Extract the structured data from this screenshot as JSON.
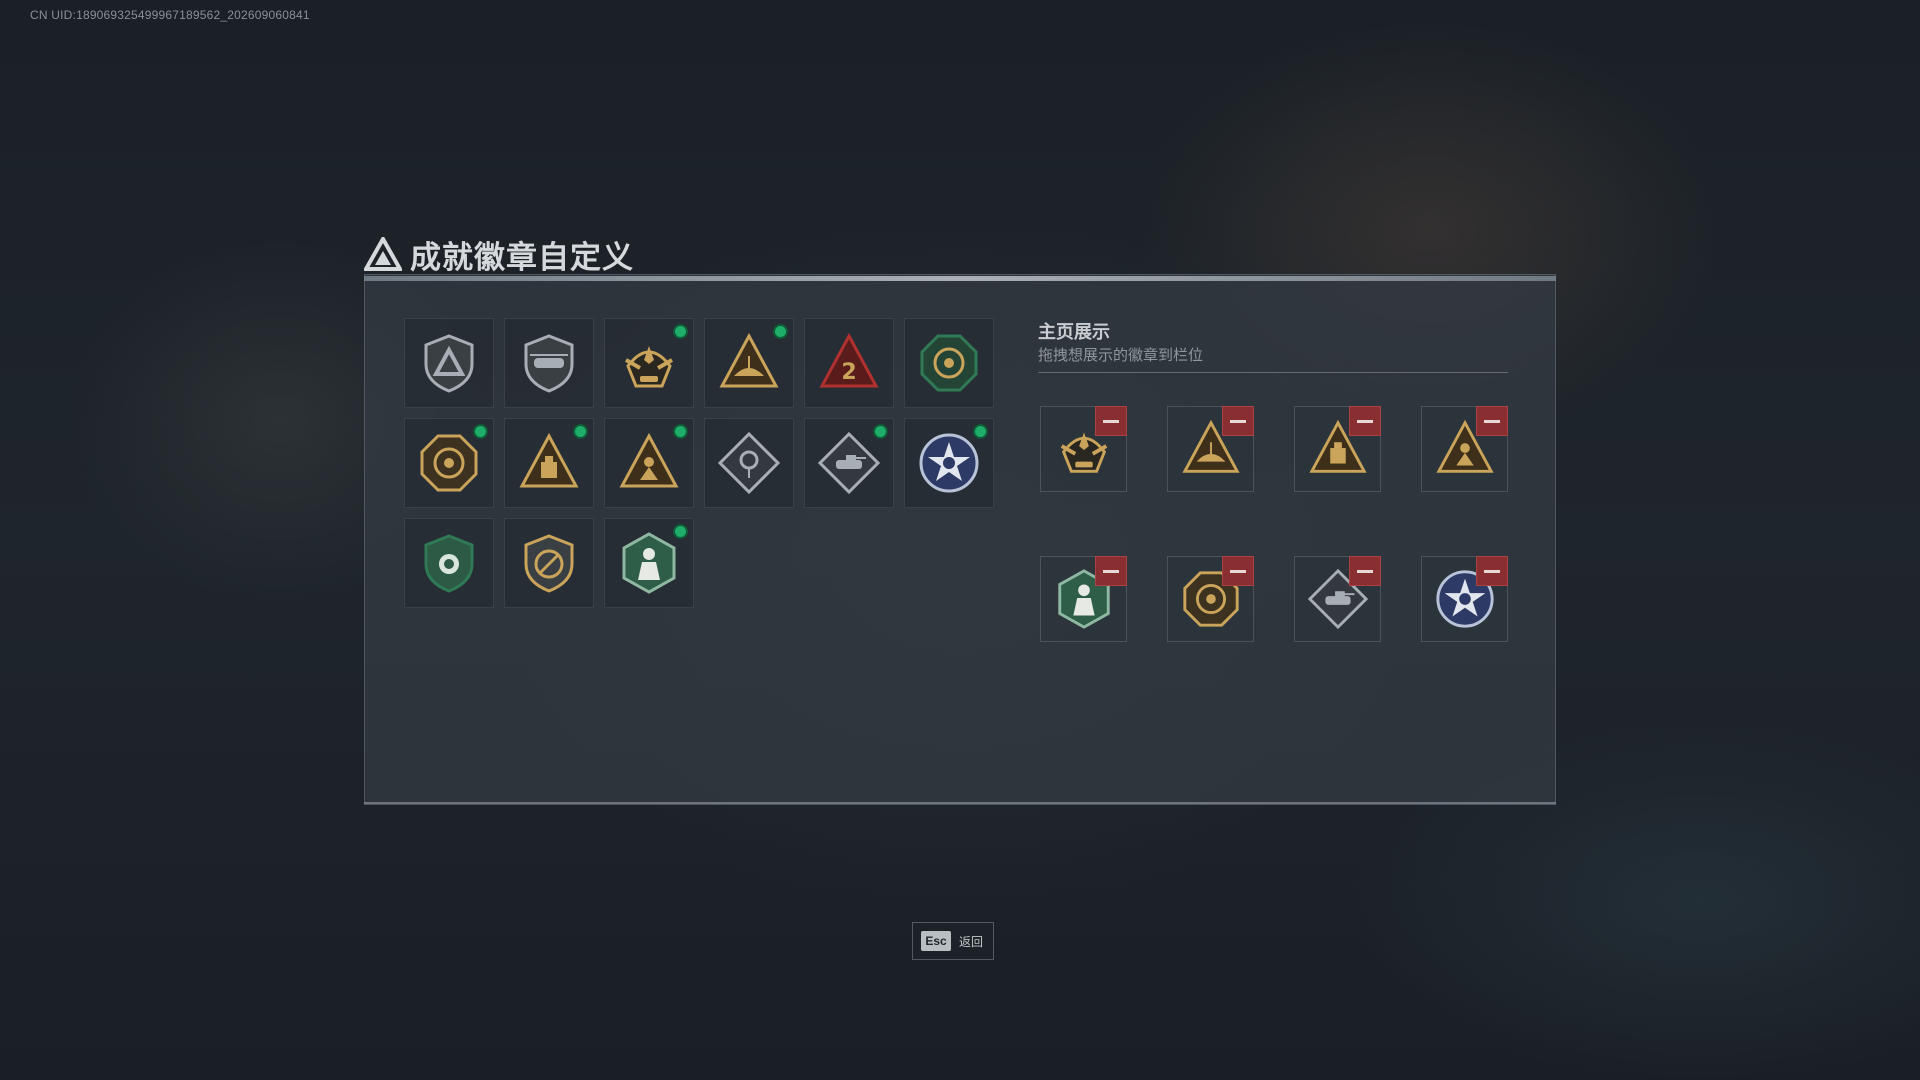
{
  "uid_text": "CN UID:18906932549996718956​2_202609060841",
  "header": {
    "title": "成就徽章自定义",
    "icon": "triangle-logo-icon"
  },
  "badge_grid": {
    "items": [
      {
        "icon": "shield-triangle-badge-icon",
        "style": "silver",
        "new": false
      },
      {
        "icon": "helicopter-shield-badge-icon",
        "style": "silver",
        "new": false
      },
      {
        "icon": "eagle-emblem-badge-icon",
        "style": "gold",
        "new": true
      },
      {
        "icon": "triangle-sailboat-badge-icon",
        "style": "gold",
        "new": true
      },
      {
        "icon": "triangle-number-2-badge-icon",
        "style": "red",
        "new": false
      },
      {
        "icon": "octagon-round-badge-icon",
        "style": "green",
        "new": false
      },
      {
        "icon": "octagon-2025-badge-icon",
        "style": "gold",
        "new": true
      },
      {
        "icon": "triangle-crate-badge-icon",
        "style": "gold",
        "new": true
      },
      {
        "icon": "triangle-soldier-badge-icon",
        "style": "gold",
        "new": true
      },
      {
        "icon": "diamond-rose-badge-icon",
        "style": "silver",
        "new": false
      },
      {
        "icon": "diamond-tank-badge-icon",
        "style": "silver",
        "new": true
      },
      {
        "icon": "star-circle-badge-icon",
        "style": "blue",
        "new": true
      },
      {
        "icon": "green-shield-badge-icon",
        "style": "green",
        "new": false
      },
      {
        "icon": "no-gun-shield-badge-icon",
        "style": "gold",
        "new": false
      },
      {
        "icon": "hexagon-soldier-badge-icon",
        "style": "green",
        "new": true
      }
    ]
  },
  "showcase": {
    "title": "主页展示",
    "subtitle": "拖拽想展示的徽章到栏位",
    "slots": [
      {
        "icon": "eagle-emblem-badge-icon",
        "style": "gold"
      },
      {
        "icon": "triangle-sailboat-badge-icon",
        "style": "gold"
      },
      {
        "icon": "triangle-crate-badge-icon",
        "style": "gold"
      },
      {
        "icon": "triangle-soldier-badge-icon",
        "style": "gold"
      },
      {
        "icon": "hexagon-soldier-badge-icon",
        "style": "green"
      },
      {
        "icon": "octagon-2025-badge-icon",
        "style": "gold"
      },
      {
        "icon": "diamond-tank-badge-icon",
        "style": "silver"
      },
      {
        "icon": "star-circle-badge-icon",
        "style": "blue"
      }
    ]
  },
  "footer": {
    "esc_key": "Esc",
    "esc_label": "返回"
  },
  "colors": {
    "new_dot": "#1fae6a",
    "remove_button": "#8a2f31",
    "gold": "#c9a45a",
    "silver": "#a7aeb5",
    "red": "#b0312f",
    "green": "#2f7a55",
    "blue": "#3b4f8a"
  }
}
